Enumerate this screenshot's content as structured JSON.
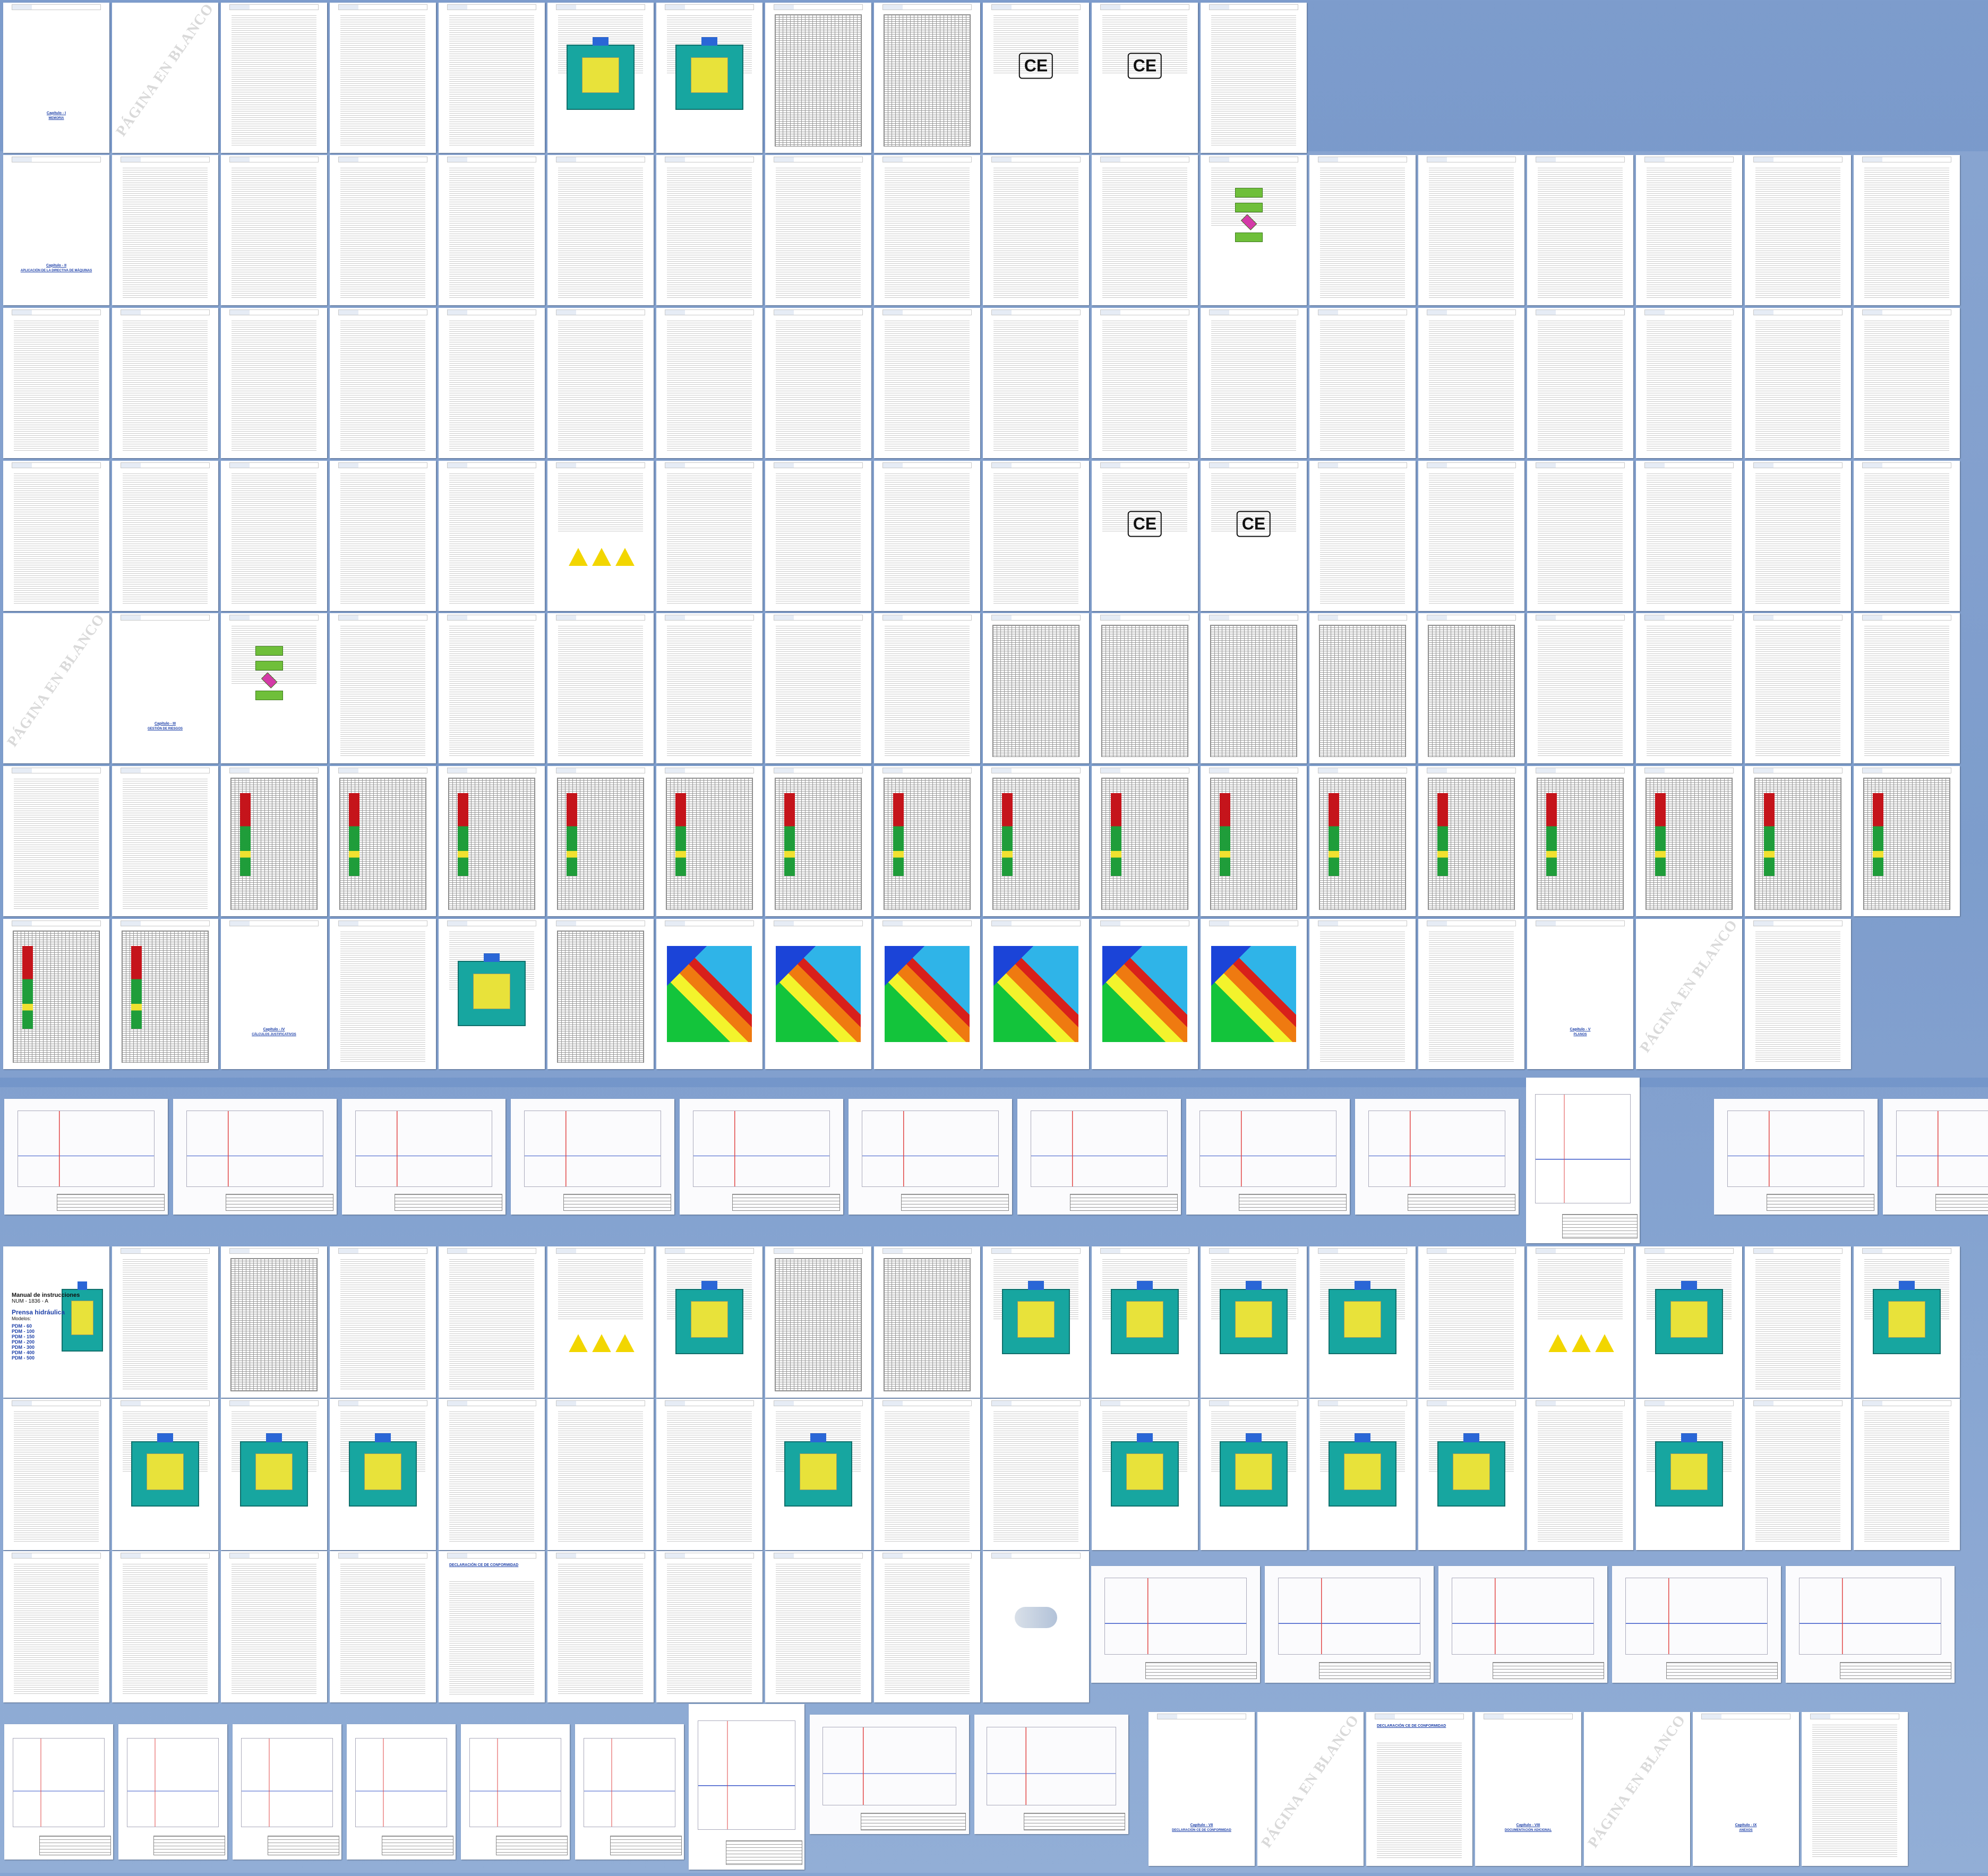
{
  "document": {
    "texts": {
      "cap1": "Capítulo - I",
      "cap1_sub": "MEMORIA",
      "cap2": "Capítulo - II",
      "cap2_sub": "APLICACIÓN DE LA DIRECTIVA DE MÁQUINAS",
      "cap3": "Capítulo - III",
      "cap3_sub": "GESTIÓN DE RIESGOS",
      "cap4": "Capítulo - IV",
      "cap4_sub": "CÁLCULOS JUSTIFICATIVOS",
      "cap5": "Capítulo - V",
      "cap5_sub": "PLANOS",
      "cap7": "Capítulo - VII",
      "cap7_sub": "DECLARACIÓN CE DE CONFORMIDAD",
      "cap8": "Capítulo - VIII",
      "cap8_sub": "DOCUMENTACIÓN ADICIONAL",
      "cap9": "Capítulo - IX",
      "cap9_sub": "ANEXOS",
      "blank": "PÁGINA EN BLANCO",
      "ce": "CE",
      "manual_title": "Manual de instrucciones",
      "manual_ref": "NUM - 1836 - A",
      "manual_product": "Prensa hidráulica",
      "manual_models_label": "Modelos:",
      "manual_models": [
        "PDM - 60",
        "PDM - 100",
        "PDM - 150",
        "PDM - 200",
        "PDM - 300",
        "PDM - 400",
        "PDM - 500"
      ],
      "declaration_title": "DECLARACIÓN CE DE CONFORMIDAD"
    },
    "colors": {
      "background": "#6f92c7",
      "machine_body": "#17a6a0",
      "risk_red": "#c5141b",
      "risk_green": "#1f9d3a",
      "caption_blue": "#1c3fa8"
    }
  }
}
